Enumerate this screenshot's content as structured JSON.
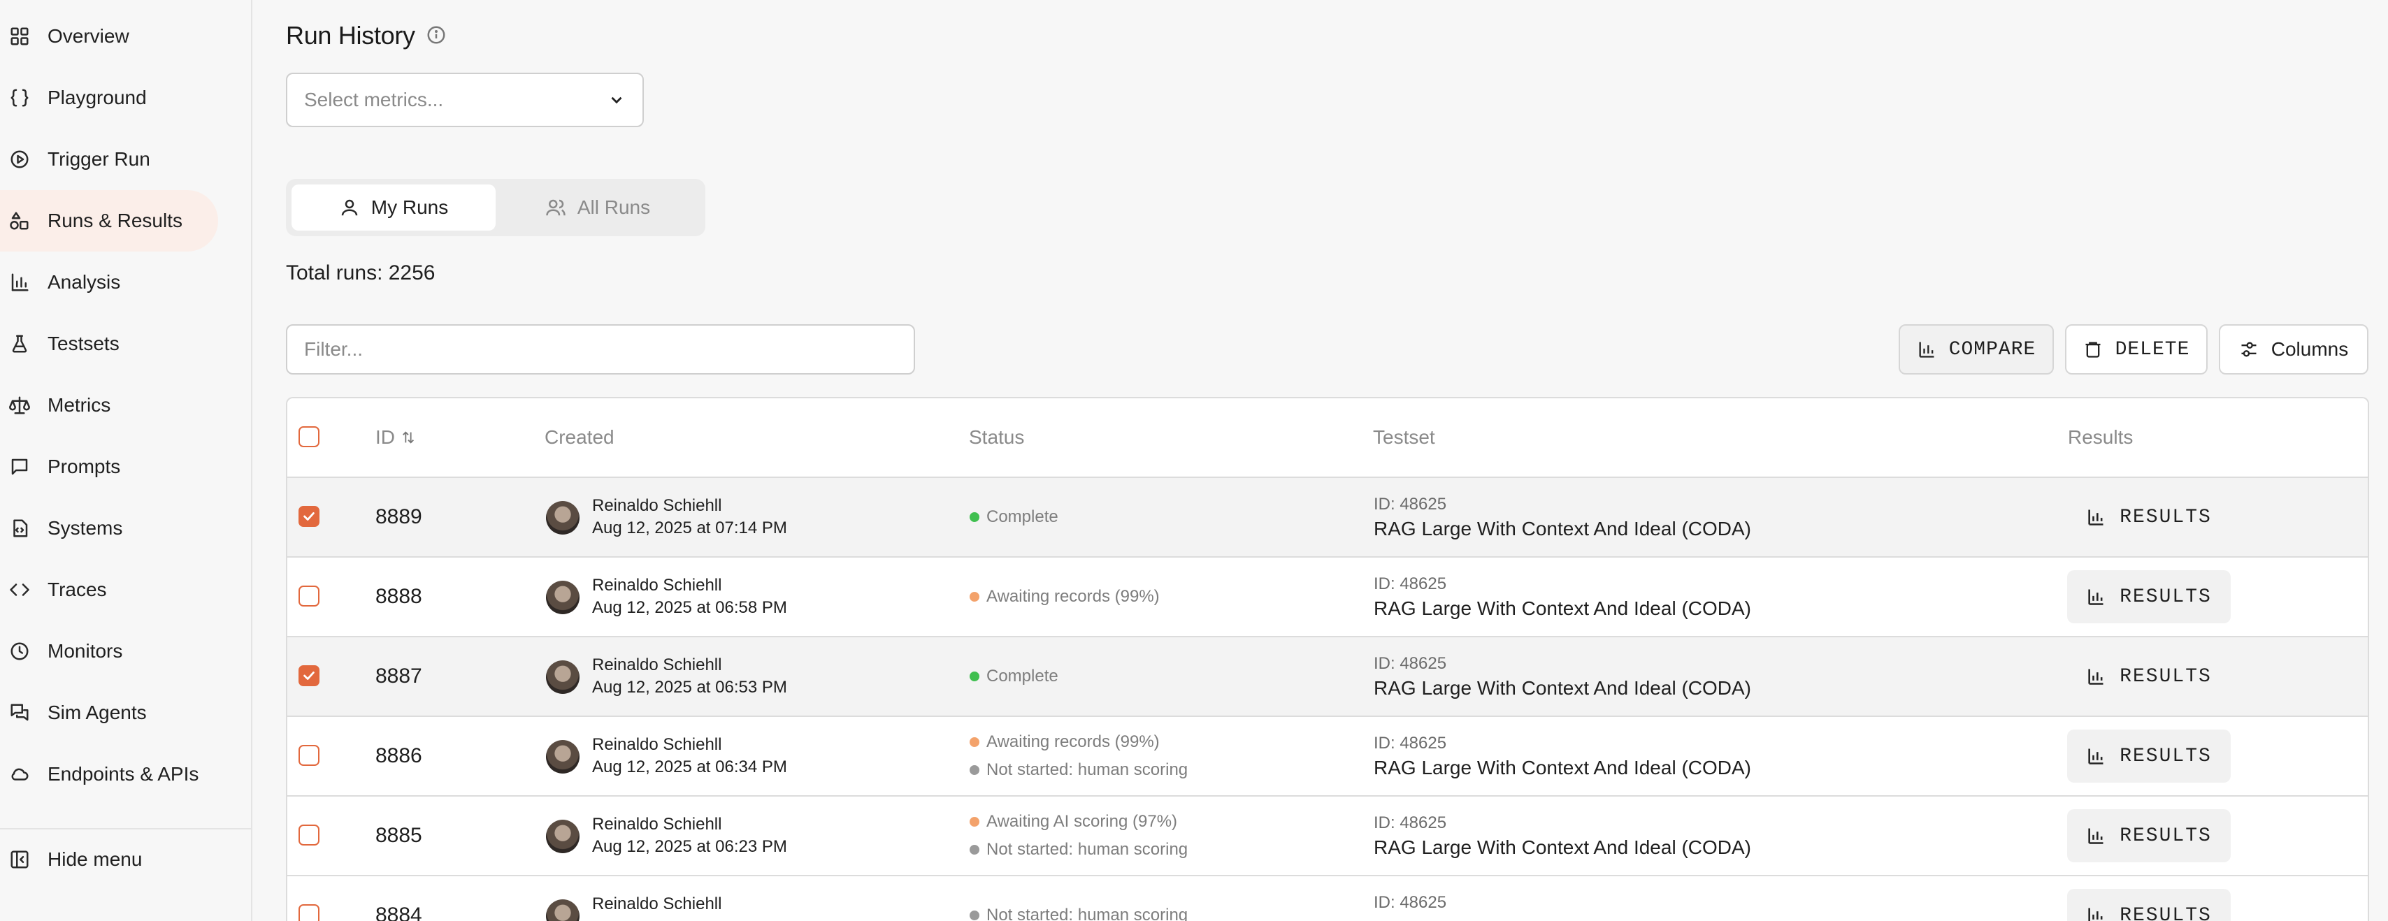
{
  "sidebar": {
    "items": [
      {
        "label": "Overview",
        "icon": "grid-icon"
      },
      {
        "label": "Playground",
        "icon": "braces-icon"
      },
      {
        "label": "Trigger Run",
        "icon": "play-circle-icon"
      },
      {
        "label": "Runs & Results",
        "icon": "shapes-icon",
        "active": true
      },
      {
        "label": "Analysis",
        "icon": "bar-chart-icon"
      },
      {
        "label": "Testsets",
        "icon": "flask-icon"
      },
      {
        "label": "Metrics",
        "icon": "scale-icon"
      },
      {
        "label": "Prompts",
        "icon": "message-icon"
      },
      {
        "label": "Systems",
        "icon": "file-code-icon"
      },
      {
        "label": "Traces",
        "icon": "code-icon"
      },
      {
        "label": "Monitors",
        "icon": "clock-icon"
      },
      {
        "label": "Sim Agents",
        "icon": "messages-icon"
      },
      {
        "label": "Endpoints & APIs",
        "icon": "cloud-icon"
      }
    ],
    "hide_menu": "Hide menu"
  },
  "header": {
    "title": "Run History"
  },
  "metrics_select": {
    "placeholder": "Select metrics..."
  },
  "toggle": {
    "my_runs": "My Runs",
    "all_runs": "All Runs"
  },
  "total_runs": "Total runs: 2256",
  "filter": {
    "placeholder": "Filter..."
  },
  "toolbar": {
    "compare": "COMPARE",
    "delete": "DELETE",
    "columns": "Columns"
  },
  "table": {
    "headers": {
      "id": "ID",
      "created": "Created",
      "status": "Status",
      "testset": "Testset",
      "results": "Results"
    },
    "results_label": "RESULTS",
    "rows": [
      {
        "id": "8889",
        "checked": true,
        "user": "Reinaldo Schiehll",
        "date": "Aug 12, 2025 at 07:14 PM",
        "statuses": [
          {
            "text": "Complete",
            "color": "#3fbf4f"
          }
        ],
        "testset_id": "ID: 48625",
        "testset_name": "RAG Large With Context And Ideal (CODA)"
      },
      {
        "id": "8888",
        "checked": false,
        "user": "Reinaldo Schiehll",
        "date": "Aug 12, 2025 at 06:58 PM",
        "statuses": [
          {
            "text": "Awaiting records (99%)",
            "color": "#f3a26b"
          }
        ],
        "testset_id": "ID: 48625",
        "testset_name": "RAG Large With Context And Ideal (CODA)"
      },
      {
        "id": "8887",
        "checked": true,
        "user": "Reinaldo Schiehll",
        "date": "Aug 12, 2025 at 06:53 PM",
        "statuses": [
          {
            "text": "Complete",
            "color": "#3fbf4f"
          }
        ],
        "testset_id": "ID: 48625",
        "testset_name": "RAG Large With Context And Ideal (CODA)"
      },
      {
        "id": "8886",
        "checked": false,
        "user": "Reinaldo Schiehll",
        "date": "Aug 12, 2025 at 06:34 PM",
        "statuses": [
          {
            "text": "Awaiting records (99%)",
            "color": "#f3a26b"
          },
          {
            "text": "Not started: human scoring",
            "color": "#9a9a9a"
          }
        ],
        "testset_id": "ID: 48625",
        "testset_name": "RAG Large With Context And Ideal (CODA)"
      },
      {
        "id": "8885",
        "checked": false,
        "user": "Reinaldo Schiehll",
        "date": "Aug 12, 2025 at 06:23 PM",
        "statuses": [
          {
            "text": "Awaiting AI scoring (97%)",
            "color": "#f3a26b"
          },
          {
            "text": "Not started: human scoring",
            "color": "#9a9a9a"
          }
        ],
        "testset_id": "ID: 48625",
        "testset_name": "RAG Large With Context And Ideal (CODA)"
      },
      {
        "id": "8884",
        "checked": false,
        "user": "Reinaldo Schiehll",
        "date": "",
        "statuses": [
          {
            "text": "Not started: human scoring",
            "color": "#9a9a9a"
          }
        ],
        "testset_id": "ID: 48625",
        "testset_name": ""
      }
    ]
  },
  "colors": {
    "accent": "#e2683d",
    "active_nav_bg": "#fbeee9"
  }
}
